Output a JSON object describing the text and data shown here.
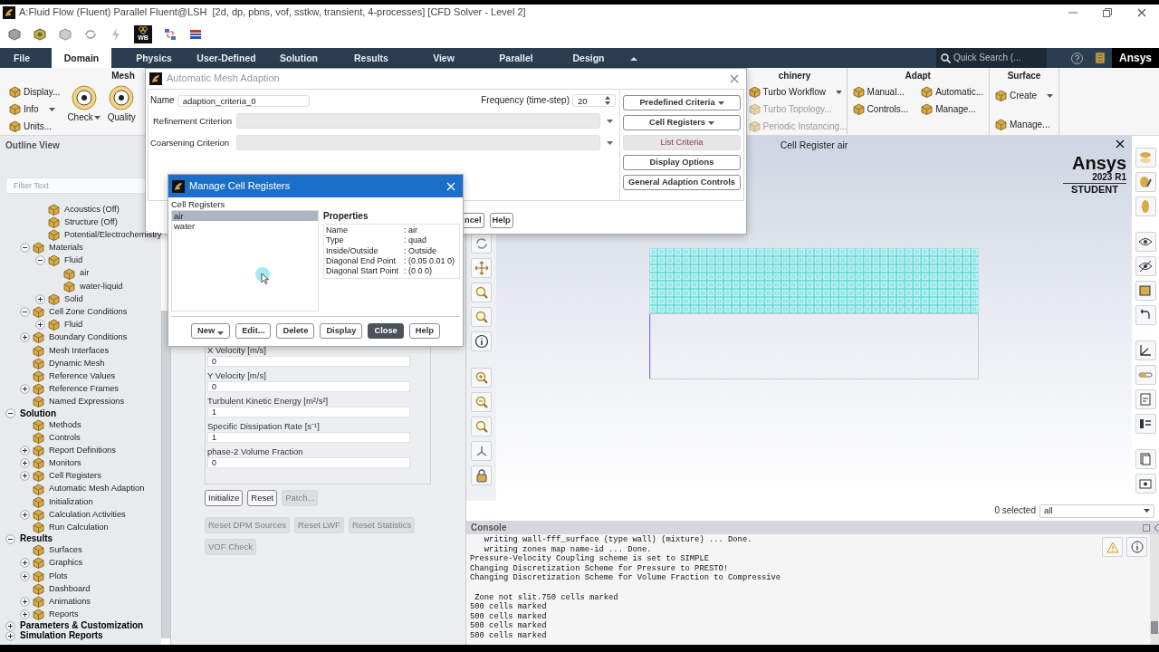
{
  "window": {
    "title": "A:Fluid Flow (Fluent) Parallel Fluent@LSH  [2d, dp, pbns, vof, sstkw, transient, 4-processes] [CFD Solver - Level 2]"
  },
  "quick_access": {
    "workbench_badge": "WB"
  },
  "ribbon_tabs": [
    {
      "label": "File",
      "selected": false
    },
    {
      "label": "Domain",
      "selected": true
    },
    {
      "label": "Physics",
      "selected": false
    },
    {
      "label": "User-Defined",
      "selected": false
    },
    {
      "label": "Solution",
      "selected": false
    },
    {
      "label": "Results",
      "selected": false
    },
    {
      "label": "View",
      "selected": false
    },
    {
      "label": "Parallel",
      "selected": false
    },
    {
      "label": "Design",
      "selected": false
    }
  ],
  "quick_search": {
    "placeholder": "Quick Search (..."
  },
  "brand": "Ansys",
  "ribbon": {
    "groups": [
      {
        "title": "Mesh",
        "columns": [
          [
            {
              "label": "Display...",
              "kind": "small",
              "menu": false,
              "disabled": false
            },
            {
              "label": "Info",
              "kind": "small",
              "menu": true,
              "disabled": false
            },
            {
              "label": "Units...",
              "kind": "small",
              "menu": false,
              "disabled": false
            }
          ],
          [
            {
              "label": "Check",
              "kind": "large",
              "menu": true,
              "disabled": false
            }
          ],
          [
            {
              "label": "Quality",
              "kind": "large",
              "menu": false,
              "disabled": false
            }
          ]
        ]
      },
      {
        "title": "chinery",
        "columns": [
          [
            {
              "label": "Turbo Workflow",
              "kind": "small",
              "menu": true,
              "disabled": false
            },
            {
              "label": "Turbo Topology...",
              "kind": "small",
              "menu": false,
              "disabled": true
            },
            {
              "label": "Periodic Instancing...",
              "kind": "small",
              "menu": false,
              "disabled": true
            }
          ]
        ]
      },
      {
        "title": "Adapt",
        "columns": [
          [
            {
              "label": "Manual...",
              "kind": "small",
              "menu": false,
              "disabled": false
            },
            {
              "label": "Controls...",
              "kind": "small",
              "menu": false,
              "disabled": false
            }
          ],
          [
            {
              "label": "Automatic...",
              "kind": "small",
              "menu": false,
              "disabled": false
            },
            {
              "label": "Manage...",
              "kind": "small",
              "menu": false,
              "disabled": false
            }
          ]
        ]
      },
      {
        "title": "Surface",
        "columns": [
          [
            {
              "label": "Create",
              "kind": "small",
              "menu": true,
              "disabled": false
            },
            {
              "label": "Manage...",
              "kind": "small",
              "menu": false,
              "disabled": false
            }
          ]
        ]
      }
    ]
  },
  "outline": {
    "title": "Outline View",
    "filter_placeholder": "Filter Text",
    "tree": [
      {
        "children": [
          {
            "children": [
              {
                "label": "Acoustics (Off)"
              },
              {
                "label": "Structure (Off)"
              },
              {
                "label": "Potential/Electrochemistry"
              }
            ]
          },
          {
            "label": "Materials",
            "expanded": true,
            "children": [
              {
                "label": "Fluid",
                "expanded": true,
                "children": [
                  {
                    "label": "air"
                  },
                  {
                    "label": "water-liquid"
                  }
                ]
              },
              {
                "label": "Solid",
                "expanded": false
              }
            ]
          },
          {
            "label": "Cell Zone Conditions",
            "expanded": true,
            "children": [
              {
                "label": "Fluid",
                "expanded": false
              }
            ]
          },
          {
            "label": "Boundary Conditions",
            "expanded": false
          },
          {
            "label": "Mesh Interfaces"
          },
          {
            "label": "Dynamic Mesh"
          },
          {
            "label": "Reference Values"
          },
          {
            "label": "Reference Frames",
            "expanded": false
          },
          {
            "label": "Named Expressions"
          }
        ]
      },
      {
        "label": "Solution",
        "expanded": true,
        "children": [
          {
            "label": "Methods"
          },
          {
            "label": "Controls"
          },
          {
            "label": "Report Definitions",
            "expanded": false
          },
          {
            "label": "Monitors",
            "expanded": false
          },
          {
            "label": "Cell Registers",
            "expanded": false
          },
          {
            "label": "Automatic Mesh Adaption"
          },
          {
            "label": "Initialization"
          },
          {
            "label": "Calculation Activities",
            "expanded": false
          },
          {
            "label": "Run Calculation"
          }
        ]
      },
      {
        "label": "Results",
        "expanded": true,
        "children": [
          {
            "label": "Surfaces"
          },
          {
            "label": "Graphics",
            "expanded": false
          },
          {
            "label": "Plots",
            "expanded": false
          },
          {
            "label": "Dashboard"
          },
          {
            "label": "Animations",
            "expanded": false
          },
          {
            "label": "Reports",
            "expanded": false
          }
        ]
      },
      {
        "label": "Parameters & Customization",
        "expanded": false
      },
      {
        "label": "Simulation Reports",
        "expanded": false
      }
    ]
  },
  "task_page": {
    "fields": [
      {
        "label": "X Velocity [m/s]",
        "value": "0"
      },
      {
        "label": "Y Velocity [m/s]",
        "value": "0"
      },
      {
        "label": "Turbulent Kinetic Energy [m²/s²]",
        "value": "1"
      },
      {
        "label": "Specific Dissipation Rate [s⁻¹]",
        "value": "1"
      },
      {
        "label": "phase-2 Volume Fraction",
        "value": "0"
      }
    ],
    "button_rows": [
      [
        {
          "label": "Initialize",
          "disabled": false
        },
        {
          "label": "Reset",
          "disabled": false
        },
        {
          "label": "Patch...",
          "disabled": true
        }
      ],
      [
        {
          "label": "Reset DPM Sources",
          "disabled": true
        },
        {
          "label": "Reset LWF",
          "disabled": true
        },
        {
          "label": "Reset Statistics",
          "disabled": true
        }
      ],
      [
        {
          "label": "VOF Check",
          "disabled": true
        }
      ]
    ]
  },
  "graphics": {
    "title": "Cell Register air",
    "logo": {
      "name": "Ansys",
      "version": "2023 R1",
      "edition": "STUDENT"
    },
    "selection": {
      "count_label": "0 selected",
      "filter": "all"
    }
  },
  "console": {
    "title": "Console",
    "blocks": [
      [
        "   writing wall-fff_surface (type wall) (mixture) ... Done.",
        "   writing zones map name-id ... Done.",
        "Pressure-Velocity Coupling scheme is set to SIMPLE",
        "Changing Discretization Scheme for Pressure to PRESTO!",
        "Changing Discretization Scheme for Volume Fraction to Compressive"
      ],
      [
        " Zone not slit.750 cells marked",
        "500 cells marked",
        "500 cells marked",
        "500 cells marked",
        "500 cells marked"
      ]
    ]
  },
  "mesh_adaption_dialog": {
    "title": "Automatic Mesh Adaption",
    "active": false,
    "name_label": "Name",
    "name_value": "adaption_criteria_0",
    "frequency_label": "Frequency (time-step)",
    "frequency_value": "20",
    "criteria": [
      {
        "label": "Refinement Criterion",
        "disabled": true
      },
      {
        "label": "Coarsening Criterion",
        "disabled": true
      }
    ],
    "side_buttons": [
      {
        "label": "Predefined Criteria",
        "menu": true,
        "pressed": false
      },
      {
        "label": "Cell Registers",
        "menu": true,
        "pressed": false
      },
      {
        "label": "List Criteria",
        "menu": false,
        "pressed": true
      },
      {
        "label": "Display Options",
        "menu": false,
        "pressed": false
      },
      {
        "label": "General Adaption Controls",
        "menu": false,
        "pressed": false
      }
    ],
    "bottom_buttons": [
      "ncel",
      "Help"
    ]
  },
  "cell_registers_dialog": {
    "title": "Manage Cell Registers",
    "active": true,
    "list_label": "Cell Registers",
    "registers": [
      {
        "label": "air",
        "selected": true
      },
      {
        "label": "water",
        "selected": false
      }
    ],
    "properties_title": "Properties",
    "properties": [
      {
        "name": "Name",
        "value": ": air"
      },
      {
        "name": "Type",
        "value": ": quad"
      },
      {
        "name": "Inside/Outside",
        "value": ": Outside"
      },
      {
        "name": "Diagonal End Point",
        "value": ": (0.05 0.01 0)"
      },
      {
        "name": "Diagonal Start Point",
        "value": ": (0 0 0)"
      }
    ],
    "buttons": [
      {
        "label": "New",
        "menu": true,
        "primary": false
      },
      {
        "label": "Edit...",
        "menu": false,
        "primary": false
      },
      {
        "label": "Delete",
        "menu": false,
        "primary": false
      },
      {
        "label": "Display",
        "menu": false,
        "primary": false
      },
      {
        "label": "Close",
        "menu": false,
        "primary": true
      },
      {
        "label": "Help",
        "menu": false,
        "primary": false
      }
    ]
  }
}
